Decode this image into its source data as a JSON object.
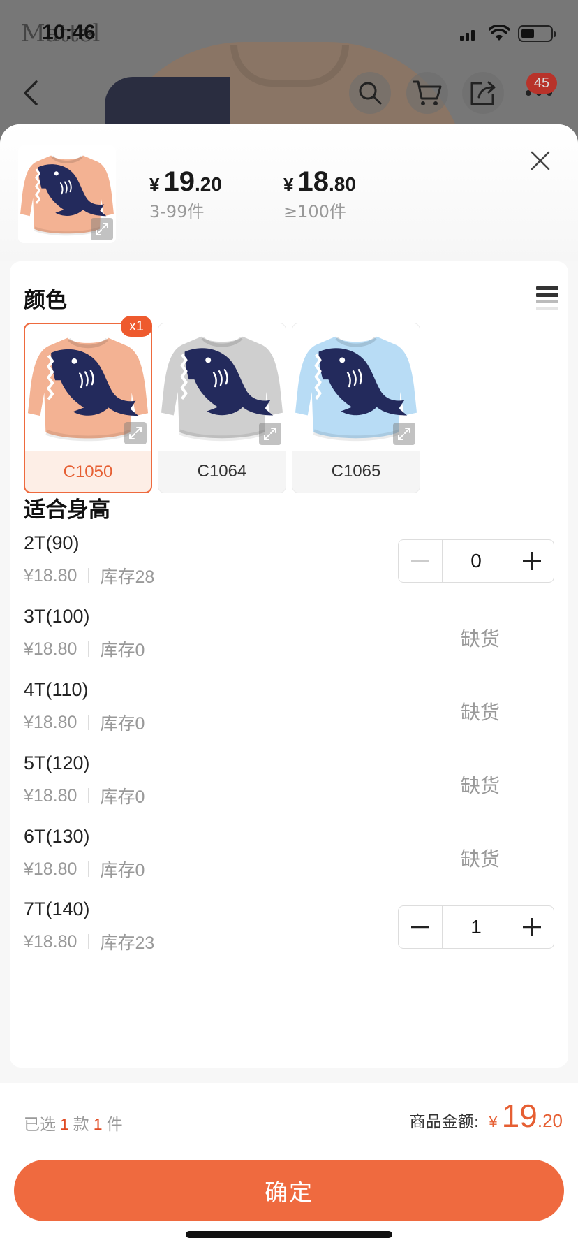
{
  "status_bar": {
    "time": "10:46",
    "battery_level": 0.45
  },
  "background": {
    "logo_text": "Mattel",
    "cart_count": "45"
  },
  "header": {
    "tiers": [
      {
        "currency": "¥",
        "integer": "19",
        "decimal": ".20",
        "range": "3-99件"
      },
      {
        "currency": "¥",
        "integer": "18",
        "decimal": ".80",
        "range": "≥100件"
      }
    ]
  },
  "color_section": {
    "title": "颜色",
    "swatches": [
      {
        "code": "C1050",
        "sweater_color": "#f3b293",
        "selected": true,
        "badge": "x1"
      },
      {
        "code": "C1064",
        "sweater_color": "#cfcfcf",
        "selected": false
      },
      {
        "code": "C1065",
        "sweater_color": "#b8dcf5",
        "selected": false
      }
    ]
  },
  "size_section": {
    "title": "适合身高",
    "rows": [
      {
        "name": "2T(90)",
        "price": "¥18.80",
        "stock": "库存28",
        "in_stock": true,
        "quantity": "0"
      },
      {
        "name": "3T(100)",
        "price": "¥18.80",
        "stock": "库存0",
        "in_stock": false,
        "status": "缺货"
      },
      {
        "name": "4T(110)",
        "price": "¥18.80",
        "stock": "库存0",
        "in_stock": false,
        "status": "缺货"
      },
      {
        "name": "5T(120)",
        "price": "¥18.80",
        "stock": "库存0",
        "in_stock": false,
        "status": "缺货"
      },
      {
        "name": "6T(130)",
        "price": "¥18.80",
        "stock": "库存0",
        "in_stock": false,
        "status": "缺货"
      },
      {
        "name": "7T(140)",
        "price": "¥18.80",
        "stock": "库存23",
        "in_stock": true,
        "quantity": "1"
      }
    ]
  },
  "footer": {
    "selected_prefix": "已选",
    "styles_count": "1",
    "styles_unit": "款",
    "pieces_count": "1",
    "pieces_unit": "件",
    "total_label": "商品金额:",
    "total_currency": "¥",
    "total_integer": "19",
    "total_decimal": ".20",
    "confirm_label": "确定"
  },
  "colors": {
    "accent": "#ef6a3f",
    "badge": "#ee5a2e",
    "shark_navy": "#232a5c"
  }
}
